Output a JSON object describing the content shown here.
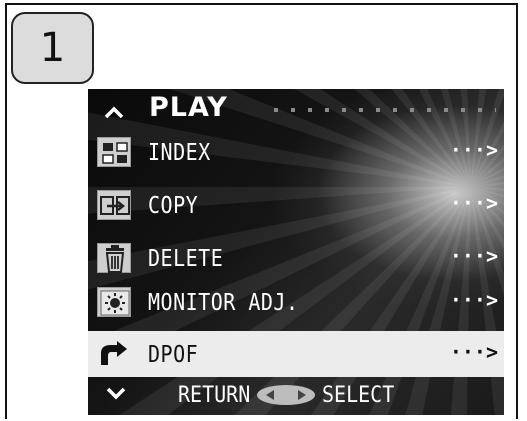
{
  "step_badge": {
    "number": "1"
  },
  "menu": {
    "title": "PLAY",
    "items": [
      {
        "label": "INDEX",
        "icon": "index-grid-icon",
        "chevron": "···>"
      },
      {
        "label": "COPY",
        "icon": "copy-icon",
        "chevron": "···>"
      },
      {
        "label": "DELETE",
        "icon": "trash-icon",
        "chevron": "···>"
      },
      {
        "label": "MONITOR ADJ.",
        "icon": "monitor-brightness-icon",
        "chevron": "···>"
      },
      {
        "label": "DPOF",
        "icon": "dpof-print-icon",
        "chevron": "···>",
        "selected": true
      }
    ],
    "footer": {
      "return_label": "RETURN",
      "select_label": "SELECT"
    }
  },
  "colors": {
    "selection": "#ececec",
    "screen_bg": "#111111",
    "text": "#ffffff"
  }
}
